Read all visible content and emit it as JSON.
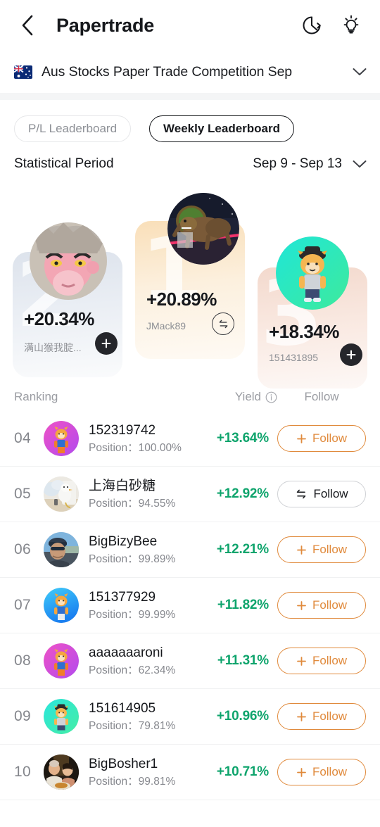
{
  "nav": {
    "back_icon": "chevron-left-icon",
    "title": "Papertrade",
    "refresh_icon": "refresh-icon",
    "tips_icon": "lightbulb-icon"
  },
  "competition": {
    "flag_icon": "australia-flag-icon",
    "name": "Aus Stocks Paper Trade Competition Sep",
    "caret_icon": "chevron-down-icon"
  },
  "tabs": [
    {
      "label": "P/L Leaderboard",
      "active": false
    },
    {
      "label": "Weekly Leaderboard",
      "active": true
    }
  ],
  "period": {
    "label": "Statistical Period",
    "value": "Sep 9 - Sep 13",
    "caret_icon": "chevron-down-icon"
  },
  "podium": [
    {
      "rank": "1",
      "yield": "+20.89%",
      "name": "JMack89",
      "button_state": "following",
      "button_icon": "swap-arrows-icon",
      "avatar_colors": [
        "#2b2340",
        "#1b2c4a"
      ]
    },
    {
      "rank": "2",
      "yield": "+20.34%",
      "name": "满山猴我腚...",
      "button_state": "follow",
      "button_icon": "plus-icon",
      "avatar_colors": [
        "#f0a9b6",
        "#c9c2bb"
      ]
    },
    {
      "rank": "3",
      "yield": "+18.34%",
      "name": "151431895",
      "button_state": "follow",
      "button_icon": "plus-icon",
      "avatar_colors": [
        "#1fe3d0",
        "#3ae8a0"
      ]
    }
  ],
  "columns": {
    "ranking": "Ranking",
    "yield": "Yield",
    "yield_info_icon": "info-icon",
    "follow": "Follow"
  },
  "rows": [
    {
      "rank": "04",
      "name": "152319742",
      "position_label": "Position：",
      "position": "100.00%",
      "yield": "+13.64%",
      "follow_label": "Follow",
      "follow_state": "follow",
      "avatar_colors": [
        "#ef51c6",
        "#b24bee"
      ]
    },
    {
      "rank": "05",
      "name": "上海白砂糖",
      "position_label": "Position：",
      "position": "94.55%",
      "yield": "+12.92%",
      "follow_label": "Follow",
      "follow_state": "following",
      "avatar_colors": [
        "#e6eaea",
        "#ddd2be"
      ]
    },
    {
      "rank": "06",
      "name": "BigBizyBee",
      "position_label": "Position：",
      "position": "99.89%",
      "yield": "+12.21%",
      "follow_label": "Follow",
      "follow_state": "follow",
      "avatar_colors": [
        "#6fa8d6",
        "#39424c"
      ]
    },
    {
      "rank": "07",
      "name": "151377929",
      "position_label": "Position：",
      "position": "99.99%",
      "yield": "+11.82%",
      "follow_label": "Follow",
      "follow_state": "follow",
      "avatar_colors": [
        "#35c6f7",
        "#1a7ff0"
      ]
    },
    {
      "rank": "08",
      "name": "aaaaaaaroni",
      "position_label": "Position：",
      "position": "62.34%",
      "yield": "+11.31%",
      "follow_label": "Follow",
      "follow_state": "follow",
      "avatar_colors": [
        "#ef51c6",
        "#b24bee"
      ]
    },
    {
      "rank": "09",
      "name": "151614905",
      "position_label": "Position：",
      "position": "79.81%",
      "yield": "+10.96%",
      "follow_label": "Follow",
      "follow_state": "follow",
      "avatar_colors": [
        "#31e8d6",
        "#43edaa"
      ]
    },
    {
      "rank": "10",
      "name": "BigBosher1",
      "position_label": "Position：",
      "position": "99.81%",
      "yield": "+10.71%",
      "follow_label": "Follow",
      "follow_state": "follow",
      "avatar_colors": [
        "#5d4a36",
        "#a8783f"
      ]
    }
  ],
  "colors": {
    "yield_green": "#0ea46c",
    "follow_orange": "#e08a3c",
    "text_primary": "#16181c",
    "text_secondary": "#86888e"
  }
}
